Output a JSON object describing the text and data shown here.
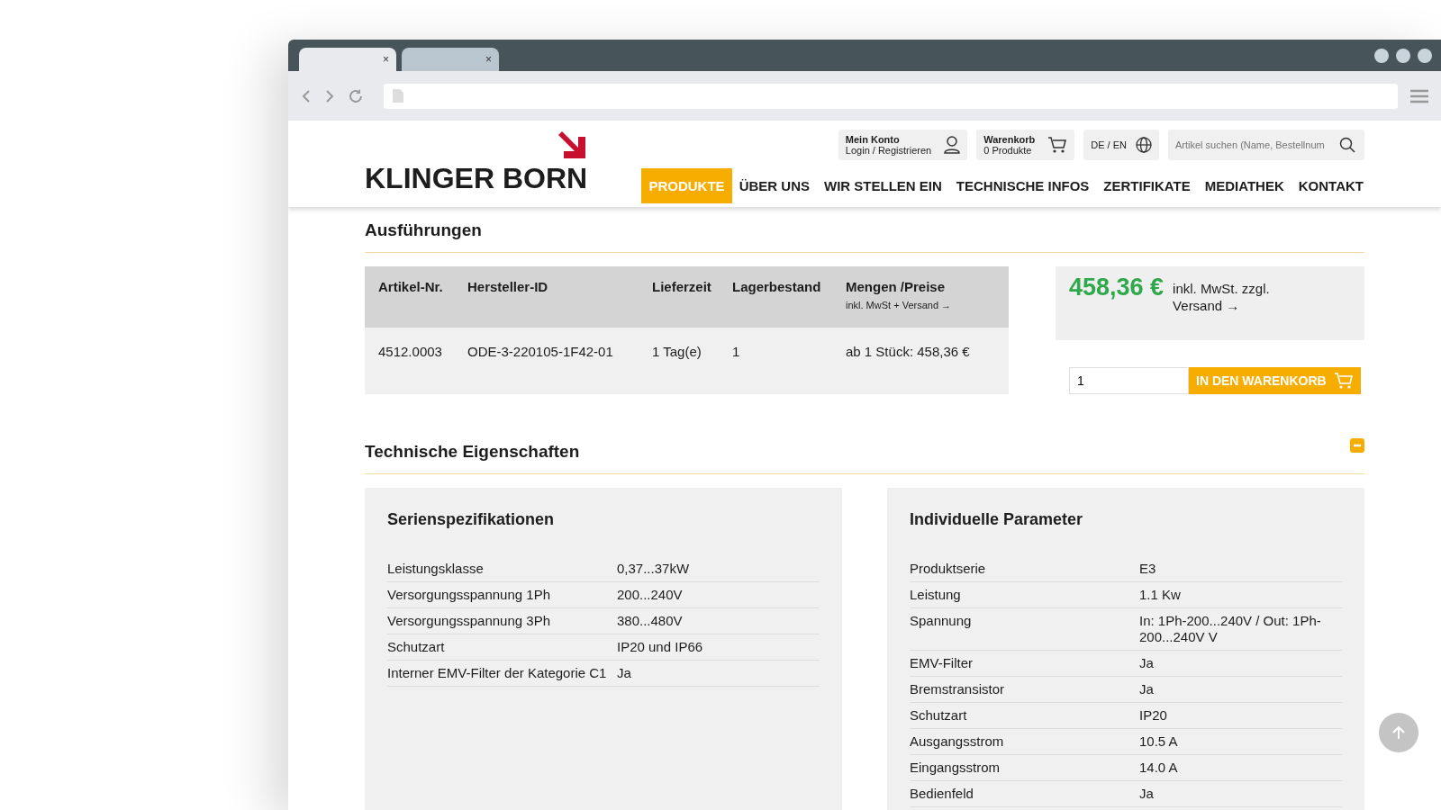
{
  "browser": {
    "tabs": [
      {
        "close": "×",
        "selected": true
      },
      {
        "close": "×",
        "selected": false
      }
    ]
  },
  "header": {
    "account": {
      "title": "Mein Konto",
      "subtitle": "Login / Registrieren"
    },
    "cart": {
      "title": "Warenkorb",
      "subtitle": "0 Produkte"
    },
    "language": "DE / EN",
    "search": {
      "placeholder": "Artikel suchen (Name, Bestellnum"
    },
    "logo": "KLINGER BORN",
    "nav": [
      {
        "label": "PRODUKTE",
        "selected": true
      },
      {
        "label": "ÜBER UNS",
        "selected": false
      },
      {
        "label": "WIR STELLEN EIN",
        "selected": false
      },
      {
        "label": "TECHNISCHE INFOS",
        "selected": false
      },
      {
        "label": "ZERTIFIKATE",
        "selected": false
      },
      {
        "label": "MEDIATHEK",
        "selected": false
      },
      {
        "label": "KONTAKT",
        "selected": false
      }
    ]
  },
  "variants": {
    "title": "Ausführungen",
    "columns": [
      "Artikel-Nr.",
      "Hersteller-ID",
      "Lieferzeit",
      "Lagerbestand",
      "Mengen /Preise"
    ],
    "price_note": "inkl. MwSt + Versand →",
    "rows": [
      [
        "4512.0003",
        "ODE-3-220105-1F42-01",
        "1 Tag(e)",
        "1",
        "ab 1 Stück: 458,36 €"
      ]
    ]
  },
  "price": {
    "amount": "458,36 €",
    "note": "inkl. MwSt. zzgl.",
    "link": "Versand →",
    "quantity": "1",
    "button": "IN DEN WARENKORB"
  },
  "tech": {
    "title": "Technische Eigenschaften",
    "expanded": true,
    "panels": [
      {
        "title": "Serienspezifikationen",
        "rows": [
          [
            "Leistungsklasse",
            "0,37...37kW"
          ],
          [
            "Versorgungsspannung 1Ph",
            "200...240V"
          ],
          [
            "Versorgungsspannung 3Ph",
            "380...480V"
          ],
          [
            "Schutzart",
            "IP20 und IP66"
          ],
          [
            "Interner EMV-Filter der Kategorie C1",
            "Ja"
          ]
        ]
      },
      {
        "title": "Individuelle Parameter",
        "rows": [
          [
            "Produktserie",
            "E3"
          ],
          [
            "Leistung",
            "1.1 Kw"
          ],
          [
            "Spannung",
            "In: 1Ph-200...240V / Out: 1Ph-200...240V V"
          ],
          [
            "EMV-Filter",
            "Ja"
          ],
          [
            "Bremstransistor",
            "Ja"
          ],
          [
            "Schutzart",
            "IP20"
          ],
          [
            "Ausgangsstrom",
            "10.5 A"
          ],
          [
            "Eingangsstrom",
            "14.0 A"
          ],
          [
            "Bedienfeld",
            "Ja"
          ]
        ]
      }
    ]
  }
}
